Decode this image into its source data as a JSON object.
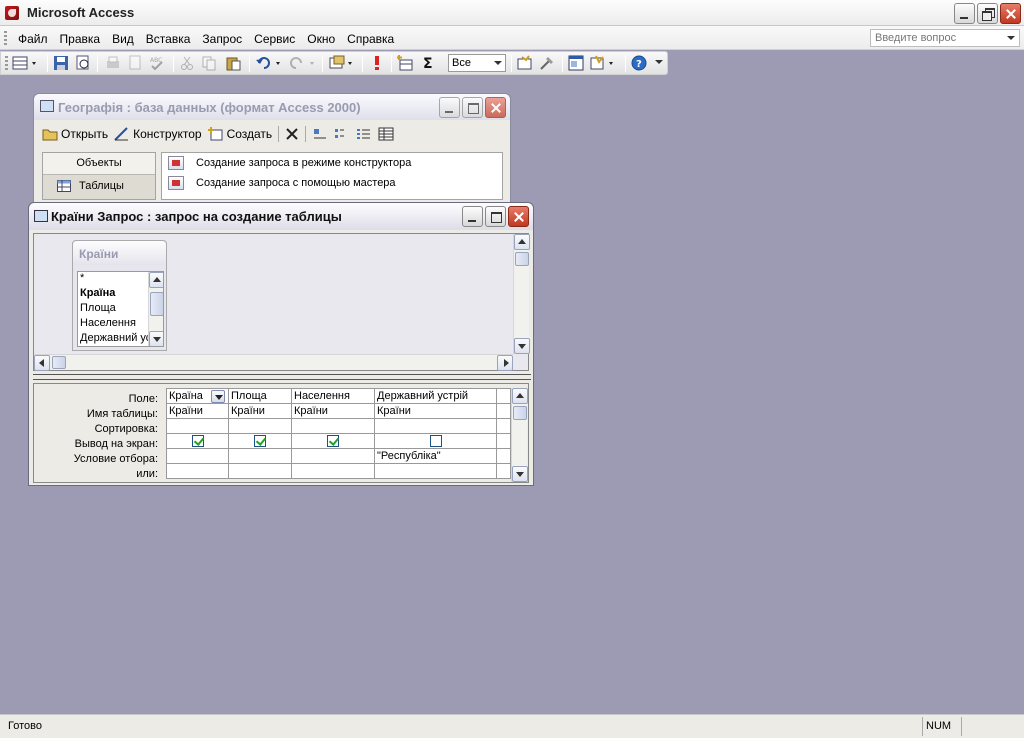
{
  "app": {
    "title": "Microsoft Access"
  },
  "menu": {
    "items": [
      "Файл",
      "Правка",
      "Вид",
      "Вставка",
      "Запрос",
      "Сервис",
      "Окно",
      "Справка"
    ],
    "ask_placeholder": "Введите вопрос"
  },
  "toolbar": {
    "top_values_combo": "Все",
    "icons": [
      "view-icon",
      "save-icon",
      "print-preview-icon",
      "print-icon",
      "preview-icon",
      "spelling-icon",
      "cut-icon",
      "copy-icon",
      "paste-icon",
      "undo-icon",
      "redo-icon",
      "query-type-icon",
      "run-icon",
      "show-table-icon",
      "totals-icon",
      "properties-icon",
      "build-icon",
      "database-window-icon",
      "new-object-icon",
      "help-icon"
    ]
  },
  "db_window": {
    "title": "Географія : база данных (формат Access 2000)",
    "toolbar": {
      "open": "Открыть",
      "design": "Конструктор",
      "create": "Создать"
    },
    "objects_header": "Объекты",
    "objects": [
      {
        "label": "Таблицы",
        "icon": "table-icon"
      }
    ],
    "list": [
      {
        "label": "Создание запроса в режиме конструктора",
        "icon": "query-wizard-icon"
      },
      {
        "label": "Создание запроса с помощью мастера",
        "icon": "query-wizard-icon"
      }
    ]
  },
  "query_window": {
    "title": "Країни Запрос : запрос на создание таблицы",
    "table": {
      "name": "Країни",
      "fields": [
        "*",
        "Країна",
        "Площа",
        "Населення",
        "Державний устрій"
      ]
    },
    "grid": {
      "row_labels": [
        "Поле:",
        "Имя таблицы:",
        "Сортировка:",
        "Вывод на экран:",
        "Условие отбора:",
        "или:"
      ],
      "columns": [
        {
          "field": "Країна",
          "table": "Країни",
          "sort": "",
          "show": true,
          "criteria": "",
          "or": ""
        },
        {
          "field": "Площа",
          "table": "Країни",
          "sort": "",
          "show": true,
          "criteria": "",
          "or": ""
        },
        {
          "field": "Населення",
          "table": "Країни",
          "sort": "",
          "show": true,
          "criteria": "",
          "or": ""
        },
        {
          "field": "Державний устрій",
          "table": "Країни",
          "sort": "",
          "show": false,
          "criteria": "\"Республіка\"",
          "or": ""
        }
      ]
    }
  },
  "status": {
    "text": "Готово",
    "num": "NUM"
  }
}
